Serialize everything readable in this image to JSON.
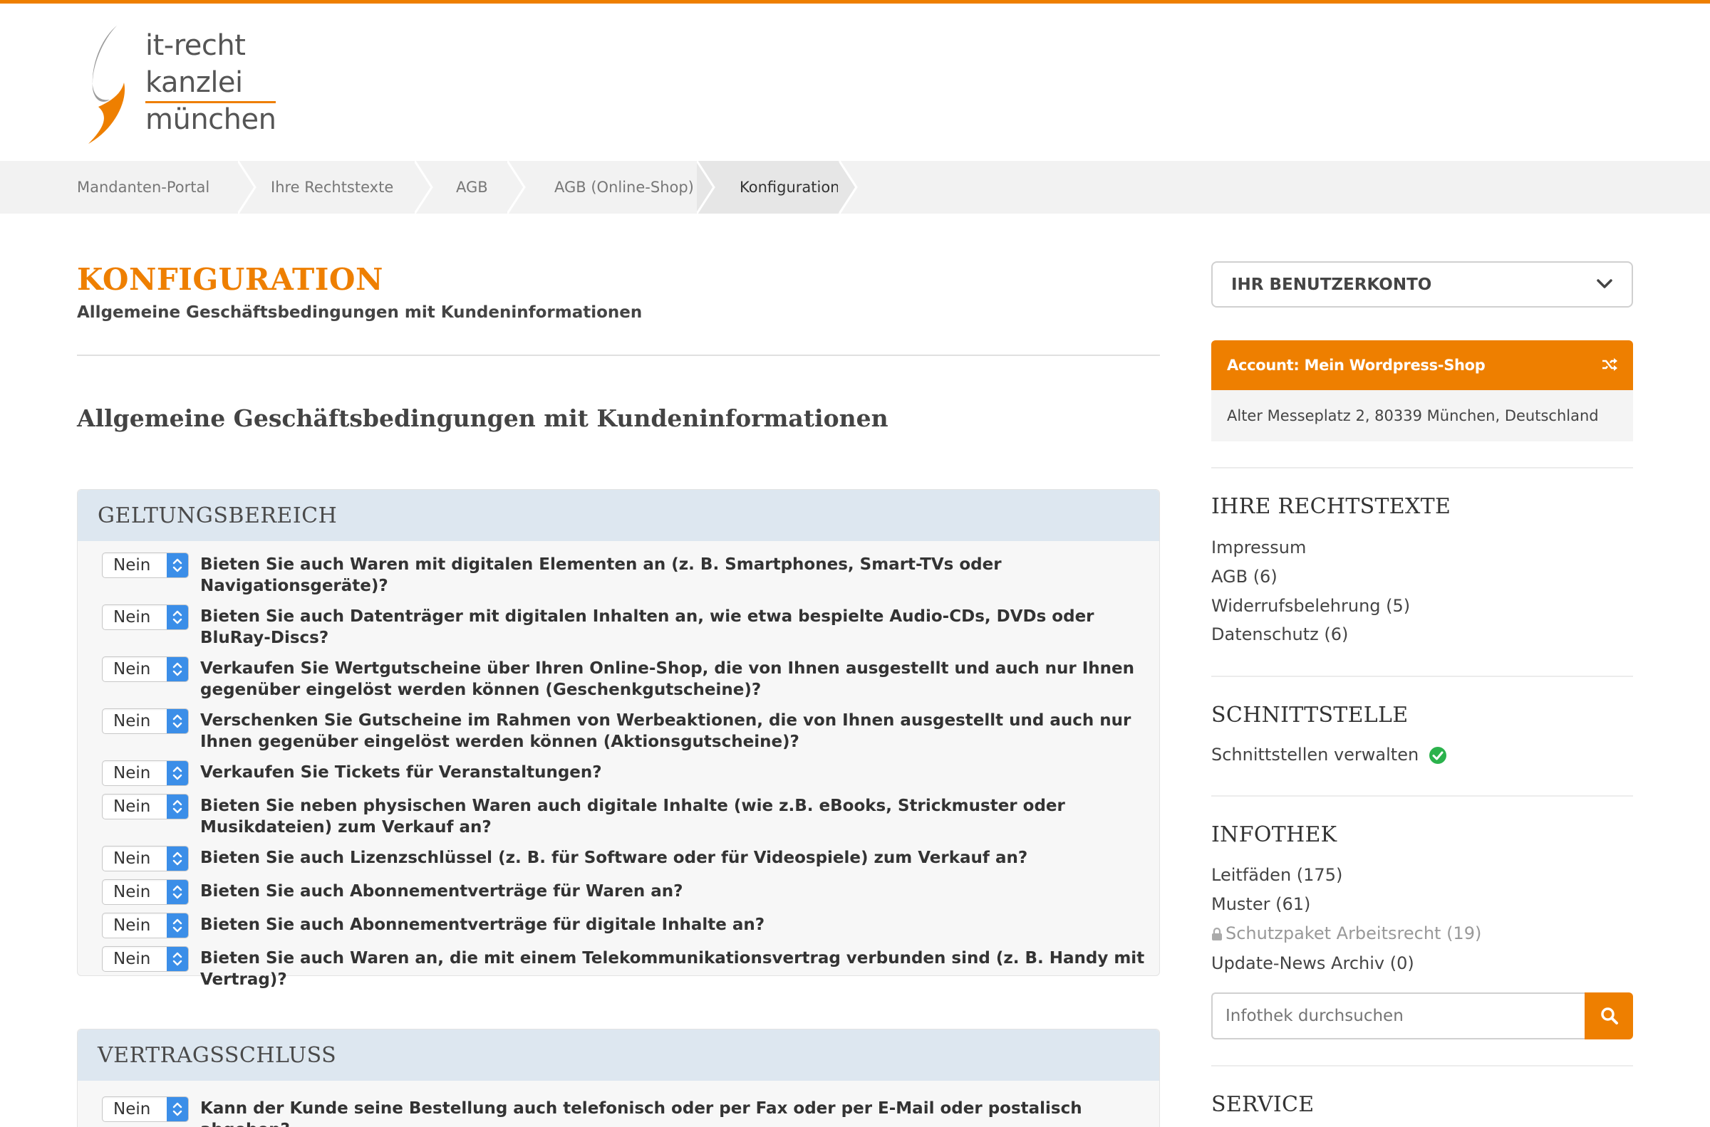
{
  "logo": {
    "line1": "it-recht",
    "line2": "kanzlei",
    "line3": "münchen"
  },
  "breadcrumb": [
    {
      "label": "Mandanten-Portal"
    },
    {
      "label": "Ihre Rechtstexte"
    },
    {
      "label": "AGB"
    },
    {
      "label": "AGB (Online-Shop)"
    },
    {
      "label": "Konfiguration"
    }
  ],
  "main": {
    "title": "KONFIGURATION",
    "subtitle": "Allgemeine Geschäftsbedingungen mit Kundeninformationen",
    "section_heading": "Allgemeine Geschäftsbedingungen mit Kundeninformationen",
    "panels": [
      {
        "heading": "GELTUNGSBEREICH",
        "questions": [
          {
            "value": "Nein",
            "text": "Bieten Sie auch Waren mit digitalen Elementen an (z. B. Smartphones, Smart-TVs oder Navigationsgeräte)?"
          },
          {
            "value": "Nein",
            "text": "Bieten Sie auch Datenträger mit digitalen Inhalten an, wie etwa bespielte Audio-CDs, DVDs oder BluRay-Discs?"
          },
          {
            "value": "Nein",
            "text": "Verkaufen Sie Wertgutscheine über Ihren Online-Shop, die von Ihnen ausgestellt und auch nur Ihnen gegenüber eingelöst werden können (Geschenkgutscheine)?"
          },
          {
            "value": "Nein",
            "text": "Verschenken Sie Gutscheine im Rahmen von Werbeaktionen, die von Ihnen ausgestellt und auch nur Ihnen gegenüber eingelöst werden können (Aktionsgutscheine)?"
          },
          {
            "value": "Nein",
            "text": "Verkaufen Sie Tickets für Veranstaltungen?"
          },
          {
            "value": "Nein",
            "text": "Bieten Sie neben physischen Waren auch digitale Inhalte (wie z.B. eBooks, Strickmuster oder Musikdateien) zum Verkauf an?"
          },
          {
            "value": "Nein",
            "text": "Bieten Sie auch Lizenzschlüssel (z. B. für Software oder für Videospiele) zum Verkauf an?"
          },
          {
            "value": "Nein",
            "text": "Bieten Sie auch Abonnementverträge für Waren an?"
          },
          {
            "value": "Nein",
            "text": "Bieten Sie auch Abonnementverträge für digitale Inhalte an?"
          },
          {
            "value": "Nein",
            "text": "Bieten Sie auch Waren an, die mit einem Telekommunikationsvertrag verbunden sind (z. B. Handy mit Vertrag)?"
          }
        ]
      },
      {
        "heading": "VERTRAGSSCHLUSS",
        "questions": [
          {
            "value": "Nein",
            "text": "Kann der Kunde seine Bestellung auch telefonisch oder per Fax oder per E-Mail oder postalisch abgeben?"
          }
        ]
      }
    ]
  },
  "sidebar": {
    "account_dropdown": "IHR BENUTZERKONTO",
    "account_name": "Account: Mein Wordpress-Shop",
    "account_address": "Alter Messeplatz 2, 80339 München, Deutschland",
    "rechtstexte": {
      "title": "IHRE RECHTSTEXTE",
      "links": [
        "Impressum",
        "AGB (6)",
        "Widerrufsbelehrung (5)",
        "Datenschutz (6)"
      ]
    },
    "schnittstelle": {
      "title": "SCHNITTSTELLE",
      "link": "Schnittstellen verwalten"
    },
    "infothek": {
      "title": "INFOTHEK",
      "links": [
        "Leitfäden (175)",
        "Muster (61)",
        "Schutzpaket Arbeitsrecht (19)",
        "Update-News Archiv (0)"
      ],
      "search_placeholder": "Infothek durchsuchen"
    },
    "service": {
      "title": "SERVICE"
    }
  },
  "colors": {
    "accent": "#ee7f00",
    "select_button": "#3b8ee8",
    "panel_header": "#dde7f0",
    "success": "#2bb24c"
  },
  "icons": [
    "logo-mark-icon",
    "chevron-down-icon",
    "shuffle-icon",
    "check-circle-icon",
    "lock-icon",
    "search-icon",
    "select-arrows-icon"
  ]
}
